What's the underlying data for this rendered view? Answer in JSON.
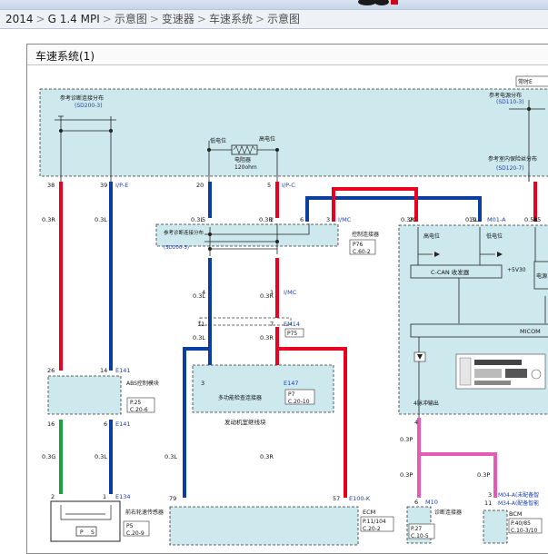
{
  "breadcrumb": {
    "items": [
      "2014",
      "G 1.4 MPI",
      "示意图",
      "变速器",
      "车速系统",
      "示意图"
    ],
    "separator": ">"
  },
  "diagram": {
    "title": "车速系统(1)",
    "colors": {
      "red": "#e8001c",
      "blue": "#0a3ea1",
      "green": "#19a33c",
      "pink": "#e45ab6",
      "box": "#cde9ee"
    },
    "top_box": {
      "ref_left": "参考诊断连接分布",
      "ref_left_code": "(SD200-3)",
      "ref_right": "参考电源分布",
      "ref_right_code": "(SD110-3)",
      "ref_right2": "参考室内保险丝分布",
      "ref_right2_code": "(SD120-7)",
      "low_pos": "低电位",
      "high_pos": "高电位",
      "resistor": "电阻器",
      "resistor_value": "120ohm",
      "corner_tag": "常时E"
    },
    "top_pins": [
      {
        "num": "38",
        "conn": ""
      },
      {
        "num": "39",
        "conn": "I/P-E"
      },
      {
        "num": "20",
        "conn": ""
      },
      {
        "num": "5",
        "conn": "I/P-C"
      },
      {
        "num": "5",
        "conn": ""
      }
    ],
    "wire_specs": {
      "w38": "0.3R",
      "w39": "0.3L",
      "w20": "0.3L",
      "w5": "0.3R",
      "w_right_r": "0.3R",
      "w_right_l": "0.3L",
      "w_far": "0.5R",
      "w4": "0.3L",
      "w2": "0.3R",
      "w11": "0.3L",
      "w7": "0.3R",
      "w16": "0.3G",
      "w6": "0.3L",
      "w_ecm_l": "0.3L",
      "w_ecm_r": "0.3R",
      "w_p1": "0.3P",
      "w_p2": "0.3P",
      "w_p3": "0.3P"
    },
    "mid_connector": {
      "pins": [
        "5",
        "2",
        "6",
        "3"
      ],
      "conn": "I/MC",
      "ref": "参考诊断连接分布",
      "ref_code": "(SD200-3)",
      "label": "控制连接器",
      "page": "P76",
      "cell": "C.60-2"
    },
    "junction_pins": {
      "p4": "4",
      "p1": "1",
      "conn": "I/MC"
    },
    "em14": {
      "p11": "11",
      "p7": "7",
      "conn": "EM14",
      "page": "P75"
    },
    "e147": {
      "pin": "3",
      "conn": "E147",
      "label": "多功能检查连接器",
      "page": "P7",
      "cell": "C.20-10",
      "harness": "发动机室继线块"
    },
    "abs": {
      "pin26": "26",
      "pin14": "14",
      "conn": "E141",
      "label": "ABS控制模块",
      "page": "P.25",
      "cell": "C.20-6",
      "pin16": "16",
      "pin6": "6",
      "conn2": "E141"
    },
    "sensor": {
      "pin2": "2",
      "pin1": "1",
      "conn": "E134",
      "label": "前右轮速传感器",
      "page": "P5",
      "cell": "C.20-9",
      "p": "P",
      "s": "S"
    },
    "ecm": {
      "pin79": "79",
      "pin57": "57",
      "conn": "E100-K",
      "label": "ECM",
      "page": "P.11/104",
      "cell": "C.20-2"
    },
    "cluster": {
      "pin20": "20",
      "pin19": "19",
      "conn": "M01-A",
      "pin15": "15",
      "high": "高电位",
      "low": "低电位",
      "can": "C-CAN 收发器",
      "v5": "+5V30",
      "power": "电源",
      "micom": "MICOM",
      "p4": "4",
      "out": "4脉冲输出"
    },
    "diag_conn": {
      "pin": "6",
      "conn": "M10",
      "label": "诊断连接器",
      "page": "P.27",
      "cell": "C.10-5"
    },
    "bcm": {
      "pin3": "3",
      "pin11": "11",
      "conn1": "M04-A(未配备智",
      "conn2": "M34-A(配备智能",
      "label": "BCM",
      "page": "P.40/85",
      "cell": "C.10-3/10"
    }
  }
}
